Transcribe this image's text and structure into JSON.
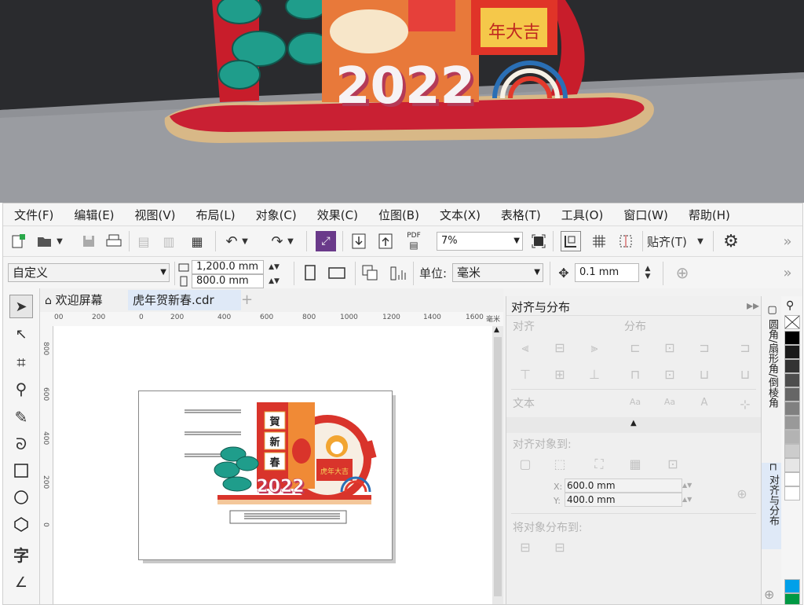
{
  "render": {
    "year_text": "2022",
    "couplet_text": "年大吉"
  },
  "menu": [
    "文件(F)",
    "编辑(E)",
    "视图(V)",
    "布局(L)",
    "对象(C)",
    "效果(C)",
    "位图(B)",
    "文本(X)",
    "表格(T)",
    "工具(O)",
    "窗口(W)",
    "帮助(H)"
  ],
  "toolbar": {
    "zoom_value": "7%",
    "snap_label": "贴齐(T)",
    "more": "»"
  },
  "propbar": {
    "page_preset": "自定义",
    "width": "1,200.0 mm",
    "height": "800.0 mm",
    "units_label": "单位:",
    "units_value": "毫米",
    "nudge": "0.1 mm",
    "more": "»"
  },
  "tabs": {
    "welcome": "欢迎屏幕",
    "document": "虎年贺新春.cdr",
    "add": "+"
  },
  "ruler": {
    "h_ticks": [
      "00",
      "200",
      "0",
      "200",
      "400",
      "600",
      "800",
      "1000",
      "1200",
      "1400",
      "1600",
      "毫米"
    ],
    "v_ticks": [
      "800",
      "600",
      "400",
      "200",
      "0"
    ]
  },
  "canvas_art": {
    "year": "2022",
    "fu_chars": [
      "賀",
      "新",
      "春"
    ],
    "couplet": "虎年大吉"
  },
  "docker": {
    "title": "对齐与分布",
    "align_label": "对齐",
    "distribute_label": "分布",
    "text_label": "文本",
    "align_to_label": "对齐对象到:",
    "x_label": "X:",
    "x_value": "600.0 mm",
    "y_label": "Y:",
    "y_value": "400.0 mm",
    "distribute_to_label": "将对象分布到:"
  },
  "vtabs": {
    "fillet": "圆角/扇形角/倒棱角",
    "align": "对齐与分布"
  },
  "palette_colors": [
    "#ffffff",
    "#000000",
    "#1a1a1a",
    "#333333",
    "#4d4d4d",
    "#666666",
    "#808080",
    "#999999",
    "#b3b3b3",
    "#cccccc",
    "#e6e6e6",
    "#ffffff",
    "#00a0e9",
    "#009944"
  ]
}
